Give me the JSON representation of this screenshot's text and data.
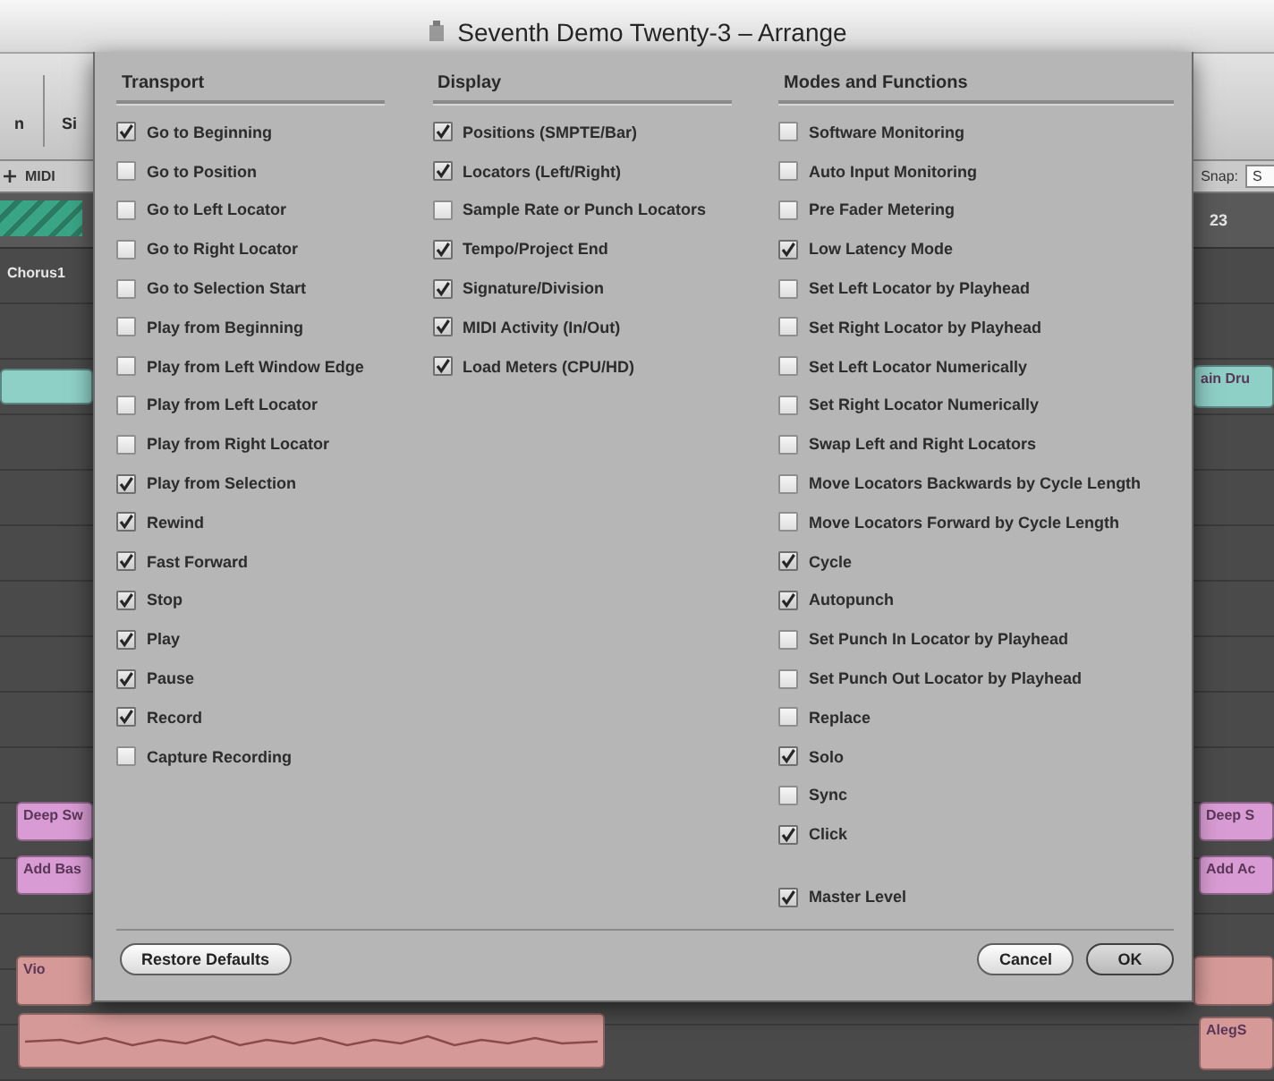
{
  "window": {
    "title": "Seventh Demo Twenty-3 – Arrange"
  },
  "arrange": {
    "toolbar_labels": [
      "n",
      "Si"
    ],
    "track_label": "MIDI",
    "snap_label": "Snap:",
    "snap_value": "S",
    "bar_number": "23",
    "marker": "Chorus1",
    "left_regions": [
      {
        "kind": "stripes",
        "color": "#3aa585"
      },
      {
        "kind": "region",
        "color": "#8ecfc6"
      },
      {
        "kind": "region",
        "label": "Deep Sw",
        "color": "#d89bd3"
      },
      {
        "kind": "region",
        "label": "Add Bas",
        "color": "#d89bd3"
      },
      {
        "kind": "region",
        "label": "Vio",
        "color": "#d59a98"
      },
      {
        "kind": "waveform",
        "color": "#d59a98"
      }
    ],
    "right_regions": [
      {
        "label": "ain Dru",
        "color": "#8ecfc6"
      },
      {
        "label": "Deep S",
        "color": "#d89bd3"
      },
      {
        "label": "Add Ac",
        "color": "#d89bd3"
      },
      {
        "color": "#d59a98"
      },
      {
        "label": "AlegS",
        "color": "#d59a98"
      }
    ]
  },
  "dialog": {
    "columns": [
      {
        "title": "Transport",
        "groups": [
          {
            "items": [
              {
                "label": "Go to Beginning",
                "checked": true
              },
              {
                "label": "Go to Position",
                "checked": false
              },
              {
                "label": "Go to Left Locator",
                "checked": false
              },
              {
                "label": "Go to Right Locator",
                "checked": false
              },
              {
                "label": "Go to Selection Start",
                "checked": false
              },
              {
                "label": "Play from Beginning",
                "checked": false
              },
              {
                "label": "Play from Left Window Edge",
                "checked": false
              },
              {
                "label": "Play from Left Locator",
                "checked": false
              },
              {
                "label": "Play from Right Locator",
                "checked": false
              },
              {
                "label": "Play from Selection",
                "checked": true
              },
              {
                "label": "Rewind",
                "checked": true
              },
              {
                "label": "Fast Forward",
                "checked": true
              },
              {
                "label": "Stop",
                "checked": true
              },
              {
                "label": "Play",
                "checked": true
              },
              {
                "label": "Pause",
                "checked": true
              },
              {
                "label": "Record",
                "checked": true
              },
              {
                "label": "Capture Recording",
                "checked": false
              }
            ]
          }
        ]
      },
      {
        "title": "Display",
        "groups": [
          {
            "items": [
              {
                "label": "Positions (SMPTE/Bar)",
                "checked": true
              },
              {
                "label": "Locators (Left/Right)",
                "checked": true
              },
              {
                "label": "Sample Rate or Punch Locators",
                "checked": false
              },
              {
                "label": "Tempo/Project End",
                "checked": true
              },
              {
                "label": "Signature/Division",
                "checked": true
              },
              {
                "label": "MIDI Activity (In/Out)",
                "checked": true
              },
              {
                "label": "Load Meters (CPU/HD)",
                "checked": true
              }
            ]
          }
        ]
      },
      {
        "title": "Modes and Functions",
        "groups": [
          {
            "items": [
              {
                "label": "Software Monitoring",
                "checked": false
              },
              {
                "label": "Auto Input Monitoring",
                "checked": false
              },
              {
                "label": "Pre Fader Metering",
                "checked": false
              },
              {
                "label": "Low Latency Mode",
                "checked": true
              },
              {
                "label": "Set Left Locator by Playhead",
                "checked": false
              },
              {
                "label": "Set Right Locator by Playhead",
                "checked": false
              },
              {
                "label": "Set Left Locator Numerically",
                "checked": false
              },
              {
                "label": "Set Right Locator Numerically",
                "checked": false
              },
              {
                "label": "Swap Left and Right Locators",
                "checked": false
              },
              {
                "label": "Move Locators Backwards by Cycle Length",
                "checked": false
              },
              {
                "label": "Move Locators Forward by Cycle Length",
                "checked": false
              },
              {
                "label": "Cycle",
                "checked": true
              },
              {
                "label": "Autopunch",
                "checked": true
              },
              {
                "label": "Set Punch In Locator by Playhead",
                "checked": false
              },
              {
                "label": "Set Punch Out Locator by Playhead",
                "checked": false
              },
              {
                "label": "Replace",
                "checked": false
              },
              {
                "label": "Solo",
                "checked": true
              },
              {
                "label": "Sync",
                "checked": false
              },
              {
                "label": "Click",
                "checked": true
              }
            ]
          },
          {
            "items": [
              {
                "label": "Master Level",
                "checked": true
              }
            ]
          }
        ]
      }
    ],
    "footer": {
      "reset_button": "Restore Defaults",
      "buttons": [
        {
          "label": "Cancel",
          "default": false
        },
        {
          "label": "OK",
          "default": true
        }
      ]
    }
  }
}
